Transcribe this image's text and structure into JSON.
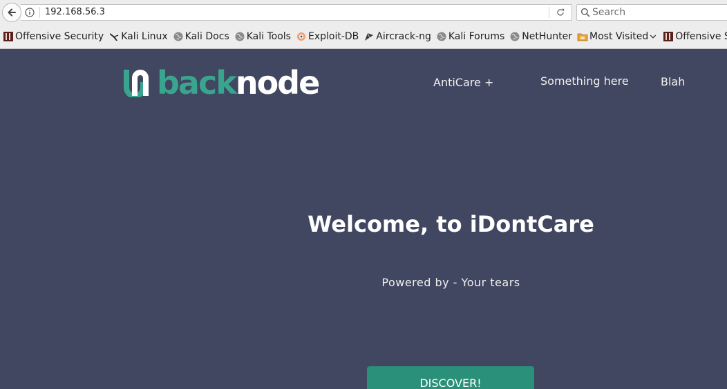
{
  "browser": {
    "url": "192.168.56.3",
    "search_placeholder": "Search",
    "bookmarks": [
      {
        "label": "Offensive Security",
        "icon": "offsec-icon"
      },
      {
        "label": "Kali Linux",
        "icon": "kali-dragon-icon"
      },
      {
        "label": "Kali Docs",
        "icon": "globe-icon"
      },
      {
        "label": "Kali Tools",
        "icon": "globe-icon"
      },
      {
        "label": "Exploit-DB",
        "icon": "exploitdb-icon"
      },
      {
        "label": "Aircrack-ng",
        "icon": "aircrack-icon"
      },
      {
        "label": "Kali Forums",
        "icon": "globe-icon"
      },
      {
        "label": "NetHunter",
        "icon": "globe-icon"
      },
      {
        "label": "Most Visited",
        "icon": "folder-icon"
      },
      {
        "label": "Offensive Security",
        "icon": "offsec-icon"
      }
    ]
  },
  "site": {
    "logo_part1": "back",
    "logo_part2": "node",
    "nav": [
      "AntiCare +",
      "Something here",
      "Blah"
    ],
    "hero_title": "Welcome, to iDontCare",
    "hero_subtitle": "Powered by - Your tears",
    "cta_label": "DISCOVER!"
  },
  "colors": {
    "background": "#414760",
    "accent": "#3aa58f",
    "button": "#2a9079"
  }
}
